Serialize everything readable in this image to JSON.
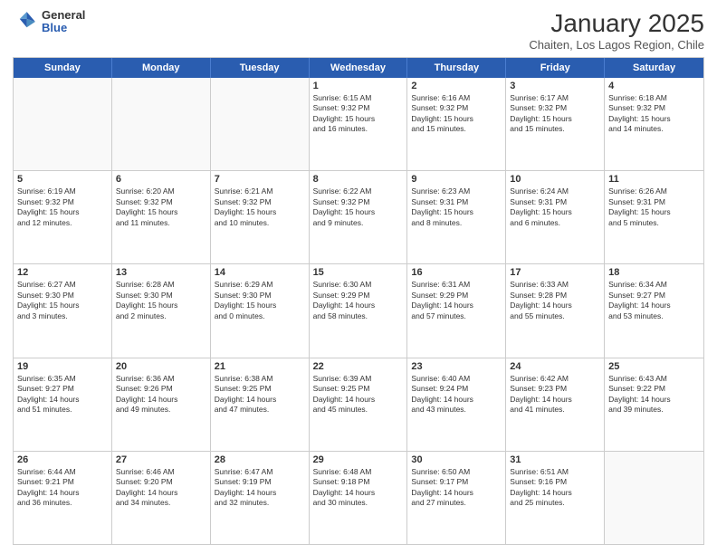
{
  "header": {
    "logo": {
      "general": "General",
      "blue": "Blue"
    },
    "title": "January 2025",
    "subtitle": "Chaiten, Los Lagos Region, Chile"
  },
  "calendar": {
    "days": [
      "Sunday",
      "Monday",
      "Tuesday",
      "Wednesday",
      "Thursday",
      "Friday",
      "Saturday"
    ],
    "rows": [
      [
        {
          "day": "",
          "text": ""
        },
        {
          "day": "",
          "text": ""
        },
        {
          "day": "",
          "text": ""
        },
        {
          "day": "1",
          "text": "Sunrise: 6:15 AM\nSunset: 9:32 PM\nDaylight: 15 hours\nand 16 minutes."
        },
        {
          "day": "2",
          "text": "Sunrise: 6:16 AM\nSunset: 9:32 PM\nDaylight: 15 hours\nand 15 minutes."
        },
        {
          "day": "3",
          "text": "Sunrise: 6:17 AM\nSunset: 9:32 PM\nDaylight: 15 hours\nand 15 minutes."
        },
        {
          "day": "4",
          "text": "Sunrise: 6:18 AM\nSunset: 9:32 PM\nDaylight: 15 hours\nand 14 minutes."
        }
      ],
      [
        {
          "day": "5",
          "text": "Sunrise: 6:19 AM\nSunset: 9:32 PM\nDaylight: 15 hours\nand 12 minutes."
        },
        {
          "day": "6",
          "text": "Sunrise: 6:20 AM\nSunset: 9:32 PM\nDaylight: 15 hours\nand 11 minutes."
        },
        {
          "day": "7",
          "text": "Sunrise: 6:21 AM\nSunset: 9:32 PM\nDaylight: 15 hours\nand 10 minutes."
        },
        {
          "day": "8",
          "text": "Sunrise: 6:22 AM\nSunset: 9:32 PM\nDaylight: 15 hours\nand 9 minutes."
        },
        {
          "day": "9",
          "text": "Sunrise: 6:23 AM\nSunset: 9:31 PM\nDaylight: 15 hours\nand 8 minutes."
        },
        {
          "day": "10",
          "text": "Sunrise: 6:24 AM\nSunset: 9:31 PM\nDaylight: 15 hours\nand 6 minutes."
        },
        {
          "day": "11",
          "text": "Sunrise: 6:26 AM\nSunset: 9:31 PM\nDaylight: 15 hours\nand 5 minutes."
        }
      ],
      [
        {
          "day": "12",
          "text": "Sunrise: 6:27 AM\nSunset: 9:30 PM\nDaylight: 15 hours\nand 3 minutes."
        },
        {
          "day": "13",
          "text": "Sunrise: 6:28 AM\nSunset: 9:30 PM\nDaylight: 15 hours\nand 2 minutes."
        },
        {
          "day": "14",
          "text": "Sunrise: 6:29 AM\nSunset: 9:30 PM\nDaylight: 15 hours\nand 0 minutes."
        },
        {
          "day": "15",
          "text": "Sunrise: 6:30 AM\nSunset: 9:29 PM\nDaylight: 14 hours\nand 58 minutes."
        },
        {
          "day": "16",
          "text": "Sunrise: 6:31 AM\nSunset: 9:29 PM\nDaylight: 14 hours\nand 57 minutes."
        },
        {
          "day": "17",
          "text": "Sunrise: 6:33 AM\nSunset: 9:28 PM\nDaylight: 14 hours\nand 55 minutes."
        },
        {
          "day": "18",
          "text": "Sunrise: 6:34 AM\nSunset: 9:27 PM\nDaylight: 14 hours\nand 53 minutes."
        }
      ],
      [
        {
          "day": "19",
          "text": "Sunrise: 6:35 AM\nSunset: 9:27 PM\nDaylight: 14 hours\nand 51 minutes."
        },
        {
          "day": "20",
          "text": "Sunrise: 6:36 AM\nSunset: 9:26 PM\nDaylight: 14 hours\nand 49 minutes."
        },
        {
          "day": "21",
          "text": "Sunrise: 6:38 AM\nSunset: 9:25 PM\nDaylight: 14 hours\nand 47 minutes."
        },
        {
          "day": "22",
          "text": "Sunrise: 6:39 AM\nSunset: 9:25 PM\nDaylight: 14 hours\nand 45 minutes."
        },
        {
          "day": "23",
          "text": "Sunrise: 6:40 AM\nSunset: 9:24 PM\nDaylight: 14 hours\nand 43 minutes."
        },
        {
          "day": "24",
          "text": "Sunrise: 6:42 AM\nSunset: 9:23 PM\nDaylight: 14 hours\nand 41 minutes."
        },
        {
          "day": "25",
          "text": "Sunrise: 6:43 AM\nSunset: 9:22 PM\nDaylight: 14 hours\nand 39 minutes."
        }
      ],
      [
        {
          "day": "26",
          "text": "Sunrise: 6:44 AM\nSunset: 9:21 PM\nDaylight: 14 hours\nand 36 minutes."
        },
        {
          "day": "27",
          "text": "Sunrise: 6:46 AM\nSunset: 9:20 PM\nDaylight: 14 hours\nand 34 minutes."
        },
        {
          "day": "28",
          "text": "Sunrise: 6:47 AM\nSunset: 9:19 PM\nDaylight: 14 hours\nand 32 minutes."
        },
        {
          "day": "29",
          "text": "Sunrise: 6:48 AM\nSunset: 9:18 PM\nDaylight: 14 hours\nand 30 minutes."
        },
        {
          "day": "30",
          "text": "Sunrise: 6:50 AM\nSunset: 9:17 PM\nDaylight: 14 hours\nand 27 minutes."
        },
        {
          "day": "31",
          "text": "Sunrise: 6:51 AM\nSunset: 9:16 PM\nDaylight: 14 hours\nand 25 minutes."
        },
        {
          "day": "",
          "text": ""
        }
      ]
    ]
  }
}
